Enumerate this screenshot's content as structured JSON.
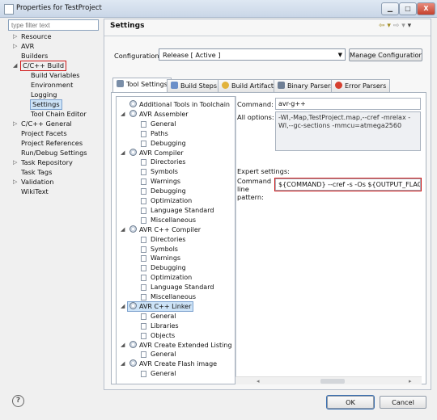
{
  "window": {
    "title": "Properties for TestProject",
    "btn_min": "▁",
    "btn_max": "□",
    "btn_close": "X"
  },
  "filter": {
    "placeholder": "type filter text"
  },
  "nav": {
    "items": [
      {
        "label": "Resource",
        "twisty": "▷"
      },
      {
        "label": "AVR",
        "twisty": "▷"
      },
      {
        "label": "Builders",
        "twisty": ""
      },
      {
        "label": "C/C++ Build",
        "twisty": "◢"
      },
      {
        "label": "Build Variables",
        "twisty": ""
      },
      {
        "label": "Environment",
        "twisty": ""
      },
      {
        "label": "Logging",
        "twisty": ""
      },
      {
        "label": "Settings",
        "twisty": ""
      },
      {
        "label": "Tool Chain Editor",
        "twisty": ""
      },
      {
        "label": "C/C++ General",
        "twisty": "▷"
      },
      {
        "label": "Project Facets",
        "twisty": ""
      },
      {
        "label": "Project References",
        "twisty": ""
      },
      {
        "label": "Run/Debug Settings",
        "twisty": ""
      },
      {
        "label": "Task Repository",
        "twisty": "▷"
      },
      {
        "label": "Task Tags",
        "twisty": ""
      },
      {
        "label": "Validation",
        "twisty": "▷"
      },
      {
        "label": "WikiText",
        "twisty": ""
      }
    ]
  },
  "header": {
    "title": "Settings",
    "nav_back": "⇦ ▾",
    "nav_fwd": "⇨ ▾",
    "menu": "▾"
  },
  "configuration": {
    "label": "Configuration:",
    "value": "Release  [ Active ]",
    "manage_label": "Manage Configurations..."
  },
  "tabs": [
    {
      "label": "Tool Settings",
      "icon_color": "#7a8ea8"
    },
    {
      "label": "Build Steps",
      "icon_color": "#6b8fc9"
    },
    {
      "label": "Build Artifact",
      "icon_color": "#e2b33c"
    },
    {
      "label": "Binary Parsers",
      "icon_color": "#6f7f95"
    },
    {
      "label": "Error Parsers",
      "icon_color": "#d64030"
    }
  ],
  "tool_tree": [
    {
      "label": "Additional Tools in Toolchain",
      "level": 0,
      "twisty": ""
    },
    {
      "label": "AVR Assembler",
      "level": 0,
      "twisty": "◢"
    },
    {
      "label": "General",
      "level": 1
    },
    {
      "label": "Paths",
      "level": 1
    },
    {
      "label": "Debugging",
      "level": 1
    },
    {
      "label": "AVR Compiler",
      "level": 0,
      "twisty": "◢"
    },
    {
      "label": "Directories",
      "level": 1
    },
    {
      "label": "Symbols",
      "level": 1
    },
    {
      "label": "Warnings",
      "level": 1
    },
    {
      "label": "Debugging",
      "level": 1
    },
    {
      "label": "Optimization",
      "level": 1
    },
    {
      "label": "Language Standard",
      "level": 1
    },
    {
      "label": "Miscellaneous",
      "level": 1
    },
    {
      "label": "AVR C++ Compiler",
      "level": 0,
      "twisty": "◢"
    },
    {
      "label": "Directories",
      "level": 1
    },
    {
      "label": "Symbols",
      "level": 1
    },
    {
      "label": "Warnings",
      "level": 1
    },
    {
      "label": "Debugging",
      "level": 1
    },
    {
      "label": "Optimization",
      "level": 1
    },
    {
      "label": "Language Standard",
      "level": 1
    },
    {
      "label": "Miscellaneous",
      "level": 1
    },
    {
      "label": "AVR C++ Linker",
      "level": 0,
      "twisty": "◢"
    },
    {
      "label": "General",
      "level": 1
    },
    {
      "label": "Libraries",
      "level": 1
    },
    {
      "label": "Objects",
      "level": 1
    },
    {
      "label": "AVR Create Extended Listing",
      "level": 0,
      "twisty": "◢"
    },
    {
      "label": "General",
      "level": 1
    },
    {
      "label": "AVR Create Flash image",
      "level": 0,
      "twisty": "◢"
    },
    {
      "label": "General",
      "level": 1
    }
  ],
  "details": {
    "command_label": "Command:",
    "command_value": "avr-g++",
    "all_options_label": "All options:",
    "all_options_value": "-Wl,-Map,TestProject.map,--cref -mrelax -Wl,--gc-sections -mmcu=atmega2560",
    "expert_label": "Expert settings:",
    "pattern_label": "Command line pattern:",
    "pattern_value": "${COMMAND} --cref -s -Os ${OUTPUT_FLAG}${C"
  },
  "footer": {
    "help_label": "?",
    "ok_label": "OK",
    "cancel_label": "Cancel"
  }
}
